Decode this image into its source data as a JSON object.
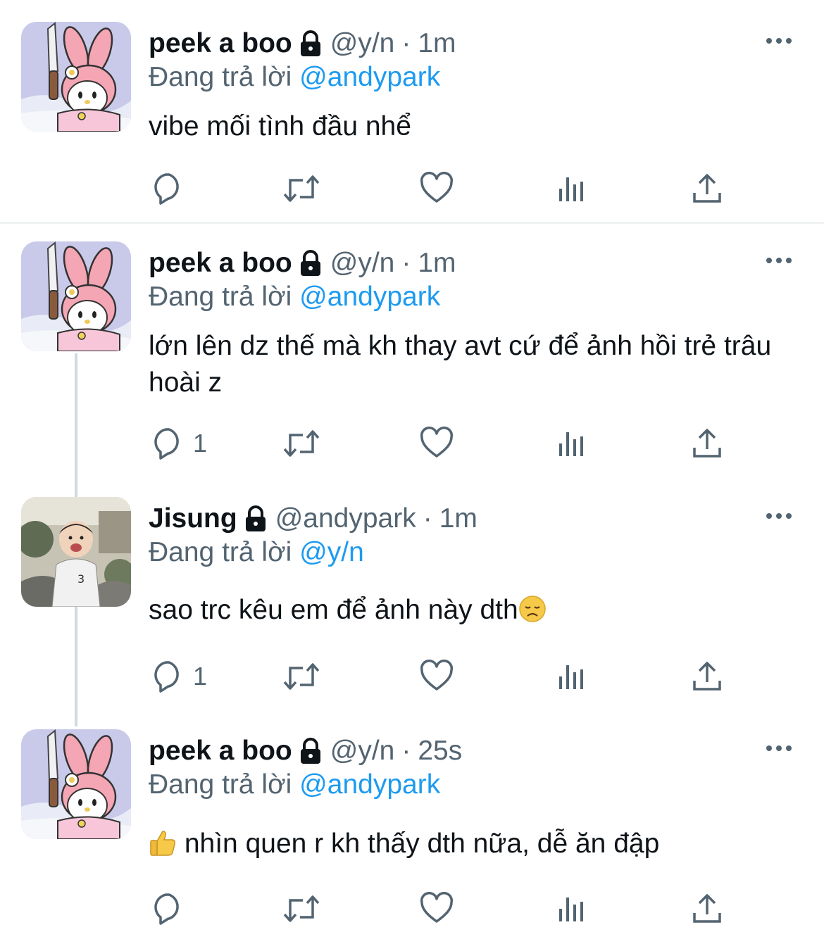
{
  "reply_prefix": "Đang trả lời",
  "tweets": [
    {
      "name": "peek a boo",
      "handle": "@y/n",
      "time": "1m",
      "reply_to": "@andypark",
      "text": " vibe mối tình đầu nhể",
      "reply_count": ""
    },
    {
      "name": "peek a boo",
      "handle": "@y/n",
      "time": "1m",
      "reply_to": "@andypark",
      "text": "lớn lên dz thế mà kh thay avt cứ để ảnh hồi trẻ trâu hoài z",
      "reply_count": "1"
    },
    {
      "name": "Jisung",
      "handle": "@andypark",
      "time": "1m",
      "reply_to": "@y/n",
      "text": "sao trc kêu em để ảnh này dth",
      "reply_count": "1"
    },
    {
      "name": "peek a boo",
      "handle": "@y/n",
      "time": "25s",
      "reply_to": "@andypark",
      "text": " nhìn quen r kh thấy dth nữa, dễ ăn đập",
      "reply_count": ""
    }
  ],
  "colors": {
    "text": "#0f1419",
    "secondary": "#536471",
    "link": "#1d9bf0",
    "thread_line": "#cfd9de",
    "divider": "#eff3f4"
  },
  "icons": [
    "lock-icon",
    "more-icon",
    "reply-icon",
    "retweet-icon",
    "like-icon",
    "views-icon",
    "share-icon",
    "disappointed-face-emoji",
    "thumbs-up-emoji"
  ]
}
